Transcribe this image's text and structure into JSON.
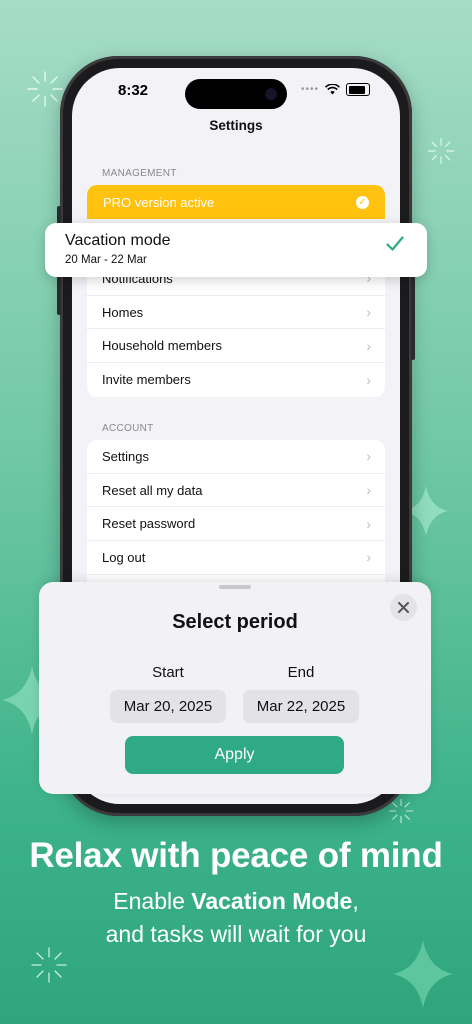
{
  "status_bar": {
    "time": "8:32",
    "dots": "••••"
  },
  "nav": {
    "title": "Settings"
  },
  "management": {
    "label": "MANAGEMENT",
    "pro": {
      "text": "PRO version active"
    },
    "items": [
      {
        "label": "Notifications"
      },
      {
        "label": "Homes"
      },
      {
        "label": "Household members"
      },
      {
        "label": "Invite members"
      }
    ]
  },
  "account": {
    "label": "ACCOUNT",
    "items": [
      {
        "label": "Settings"
      },
      {
        "label": "Reset all my data"
      },
      {
        "label": "Reset password"
      },
      {
        "label": "Log out"
      }
    ]
  },
  "vacation": {
    "title": "Vacation mode",
    "dates": "20 Mar - 22 Mar"
  },
  "sheet": {
    "title": "Select period",
    "start_label": "Start",
    "end_label": "End",
    "start_value": "Mar 20, 2025",
    "end_value": "Mar 22, 2025",
    "apply_label": "Apply"
  },
  "promo": {
    "headline": "Relax with peace of mind",
    "sub_prefix": "Enable ",
    "sub_bold": "Vacation Mode",
    "sub_suffix": ",",
    "sub_line2": "and tasks will wait for you"
  },
  "colors": {
    "accent": "#2faa86",
    "pro": "#ffc20e",
    "background": "#6fc7a5"
  }
}
